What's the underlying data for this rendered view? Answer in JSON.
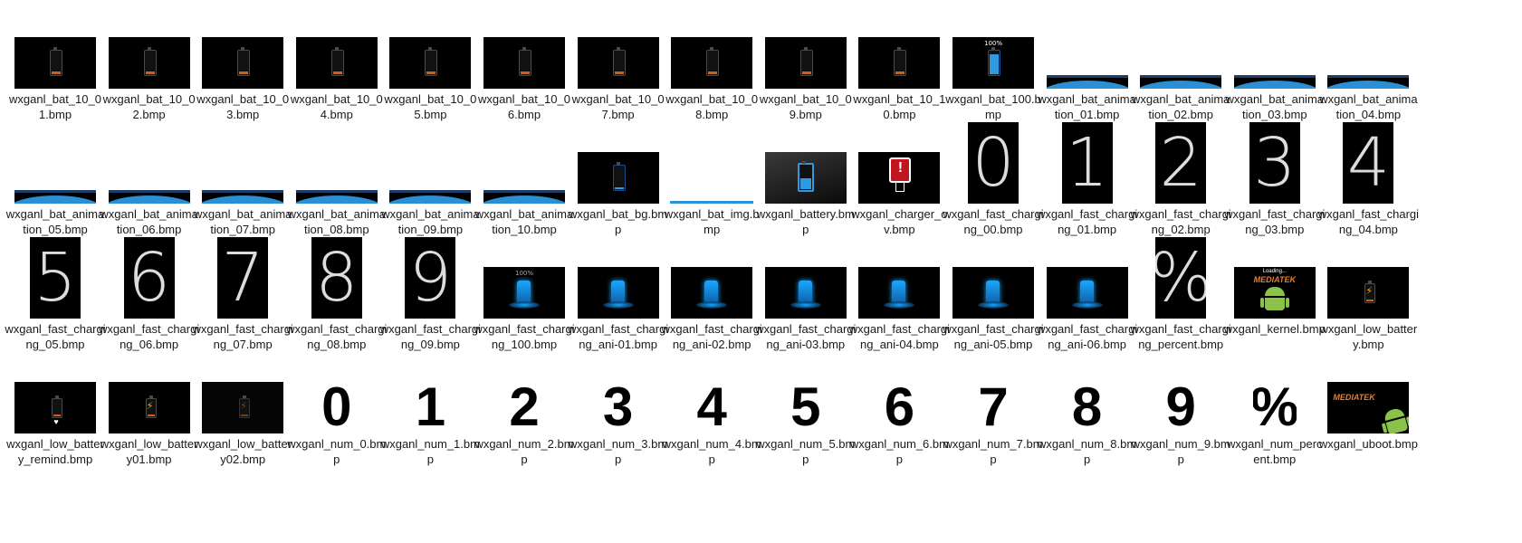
{
  "files": [
    {
      "name": "wxganl_bat_10_01.bmp",
      "kind": "bat_low"
    },
    {
      "name": "wxganl_bat_10_02.bmp",
      "kind": "bat_low"
    },
    {
      "name": "wxganl_bat_10_03.bmp",
      "kind": "bat_low"
    },
    {
      "name": "wxganl_bat_10_04.bmp",
      "kind": "bat_low"
    },
    {
      "name": "wxganl_bat_10_05.bmp",
      "kind": "bat_low"
    },
    {
      "name": "wxganl_bat_10_06.bmp",
      "kind": "bat_low"
    },
    {
      "name": "wxganl_bat_10_07.bmp",
      "kind": "bat_low"
    },
    {
      "name": "wxganl_bat_10_08.bmp",
      "kind": "bat_low"
    },
    {
      "name": "wxganl_bat_10_09.bmp",
      "kind": "bat_low"
    },
    {
      "name": "wxganl_bat_10_10.bmp",
      "kind": "bat_low"
    },
    {
      "name": "wxganl_bat_100.bmp",
      "kind": "bat_full",
      "text": "100%"
    },
    {
      "name": "wxganl_bat_animation_01.bmp",
      "kind": "anim"
    },
    {
      "name": "wxganl_bat_animation_02.bmp",
      "kind": "anim"
    },
    {
      "name": "wxganl_bat_animation_03.bmp",
      "kind": "anim"
    },
    {
      "name": "wxganl_bat_animation_04.bmp",
      "kind": "anim"
    },
    {
      "name": "wxganl_bat_animation_05.bmp",
      "kind": "anim"
    },
    {
      "name": "wxganl_bat_animation_06.bmp",
      "kind": "anim"
    },
    {
      "name": "wxganl_bat_animation_07.bmp",
      "kind": "anim"
    },
    {
      "name": "wxganl_bat_animation_08.bmp",
      "kind": "anim"
    },
    {
      "name": "wxganl_bat_animation_09.bmp",
      "kind": "anim"
    },
    {
      "name": "wxganl_bat_animation_10.bmp",
      "kind": "anim"
    },
    {
      "name": "wxganl_bat_bg.bmp",
      "kind": "bat_bg"
    },
    {
      "name": "wxganl_bat_img.bmp",
      "kind": "line"
    },
    {
      "name": "wxganl_battery.bmp",
      "kind": "battery_blue"
    },
    {
      "name": "wxganl_charger_ov.bmp",
      "kind": "charger_ov"
    },
    {
      "name": "wxganl_fast_charging_00.bmp",
      "kind": "bigdigit",
      "glyph": "0"
    },
    {
      "name": "wxganl_fast_charging_01.bmp",
      "kind": "bigdigit",
      "glyph": "1"
    },
    {
      "name": "wxganl_fast_charging_02.bmp",
      "kind": "bigdigit",
      "glyph": "2"
    },
    {
      "name": "wxganl_fast_charging_03.bmp",
      "kind": "bigdigit",
      "glyph": "3"
    },
    {
      "name": "wxganl_fast_charging_04.bmp",
      "kind": "bigdigit",
      "glyph": "4"
    },
    {
      "name": "wxganl_fast_charging_05.bmp",
      "kind": "bigdigit",
      "glyph": "5"
    },
    {
      "name": "wxganl_fast_charging_06.bmp",
      "kind": "bigdigit",
      "glyph": "6"
    },
    {
      "name": "wxganl_fast_charging_07.bmp",
      "kind": "bigdigit",
      "glyph": "7"
    },
    {
      "name": "wxganl_fast_charging_08.bmp",
      "kind": "bigdigit",
      "glyph": "8"
    },
    {
      "name": "wxganl_fast_charging_09.bmp",
      "kind": "bigdigit",
      "glyph": "9"
    },
    {
      "name": "wxganl_fast_charging_100.bmp",
      "kind": "fast_glow",
      "text": "100%"
    },
    {
      "name": "wxganl_fast_charging_ani-01.bmp",
      "kind": "fast_glow"
    },
    {
      "name": "wxganl_fast_charging_ani-02.bmp",
      "kind": "fast_glow"
    },
    {
      "name": "wxganl_fast_charging_ani-03.bmp",
      "kind": "fast_glow"
    },
    {
      "name": "wxganl_fast_charging_ani-04.bmp",
      "kind": "fast_glow"
    },
    {
      "name": "wxganl_fast_charging_ani-05.bmp",
      "kind": "fast_glow"
    },
    {
      "name": "wxganl_fast_charging_ani-06.bmp",
      "kind": "fast_glow"
    },
    {
      "name": "wxganl_fast_charging_percent.bmp",
      "kind": "bigdigit",
      "glyph": "%"
    },
    {
      "name": "wxganl_kernel.bmp",
      "kind": "kernel",
      "text": "Loading...",
      "brand": "MEDIATEK"
    },
    {
      "name": "wxganl_low_battery.bmp",
      "kind": "low_bolt"
    },
    {
      "name": "wxganl_low_battery_remind.bmp",
      "kind": "low_remind"
    },
    {
      "name": "wxganl_low_battery01.bmp",
      "kind": "low_bolt"
    },
    {
      "name": "wxganl_low_battery02.bmp",
      "kind": "low_bolt_dim"
    },
    {
      "name": "wxganl_num_0.bmp",
      "kind": "num",
      "glyph": "0"
    },
    {
      "name": "wxganl_num_1.bmp",
      "kind": "num",
      "glyph": "1"
    },
    {
      "name": "wxganl_num_2.bmp",
      "kind": "num",
      "glyph": "2"
    },
    {
      "name": "wxganl_num_3.bmp",
      "kind": "num",
      "glyph": "3"
    },
    {
      "name": "wxganl_num_4.bmp",
      "kind": "num",
      "glyph": "4"
    },
    {
      "name": "wxganl_num_5.bmp",
      "kind": "num",
      "glyph": "5"
    },
    {
      "name": "wxganl_num_6.bmp",
      "kind": "num",
      "glyph": "6"
    },
    {
      "name": "wxganl_num_7.bmp",
      "kind": "num",
      "glyph": "7"
    },
    {
      "name": "wxganl_num_8.bmp",
      "kind": "num",
      "glyph": "8"
    },
    {
      "name": "wxganl_num_9.bmp",
      "kind": "num",
      "glyph": "9"
    },
    {
      "name": "wxganl_num_percent.bmp",
      "kind": "num",
      "glyph": "%"
    },
    {
      "name": "wxganl_uboot.bmp",
      "kind": "uboot",
      "brand": "MEDIATEK"
    }
  ],
  "colors": {
    "accent_blue": "#2f8fd8",
    "low_orange": "#d35d13",
    "brand_orange": "#f07a20",
    "android_green": "#8bc34a"
  }
}
